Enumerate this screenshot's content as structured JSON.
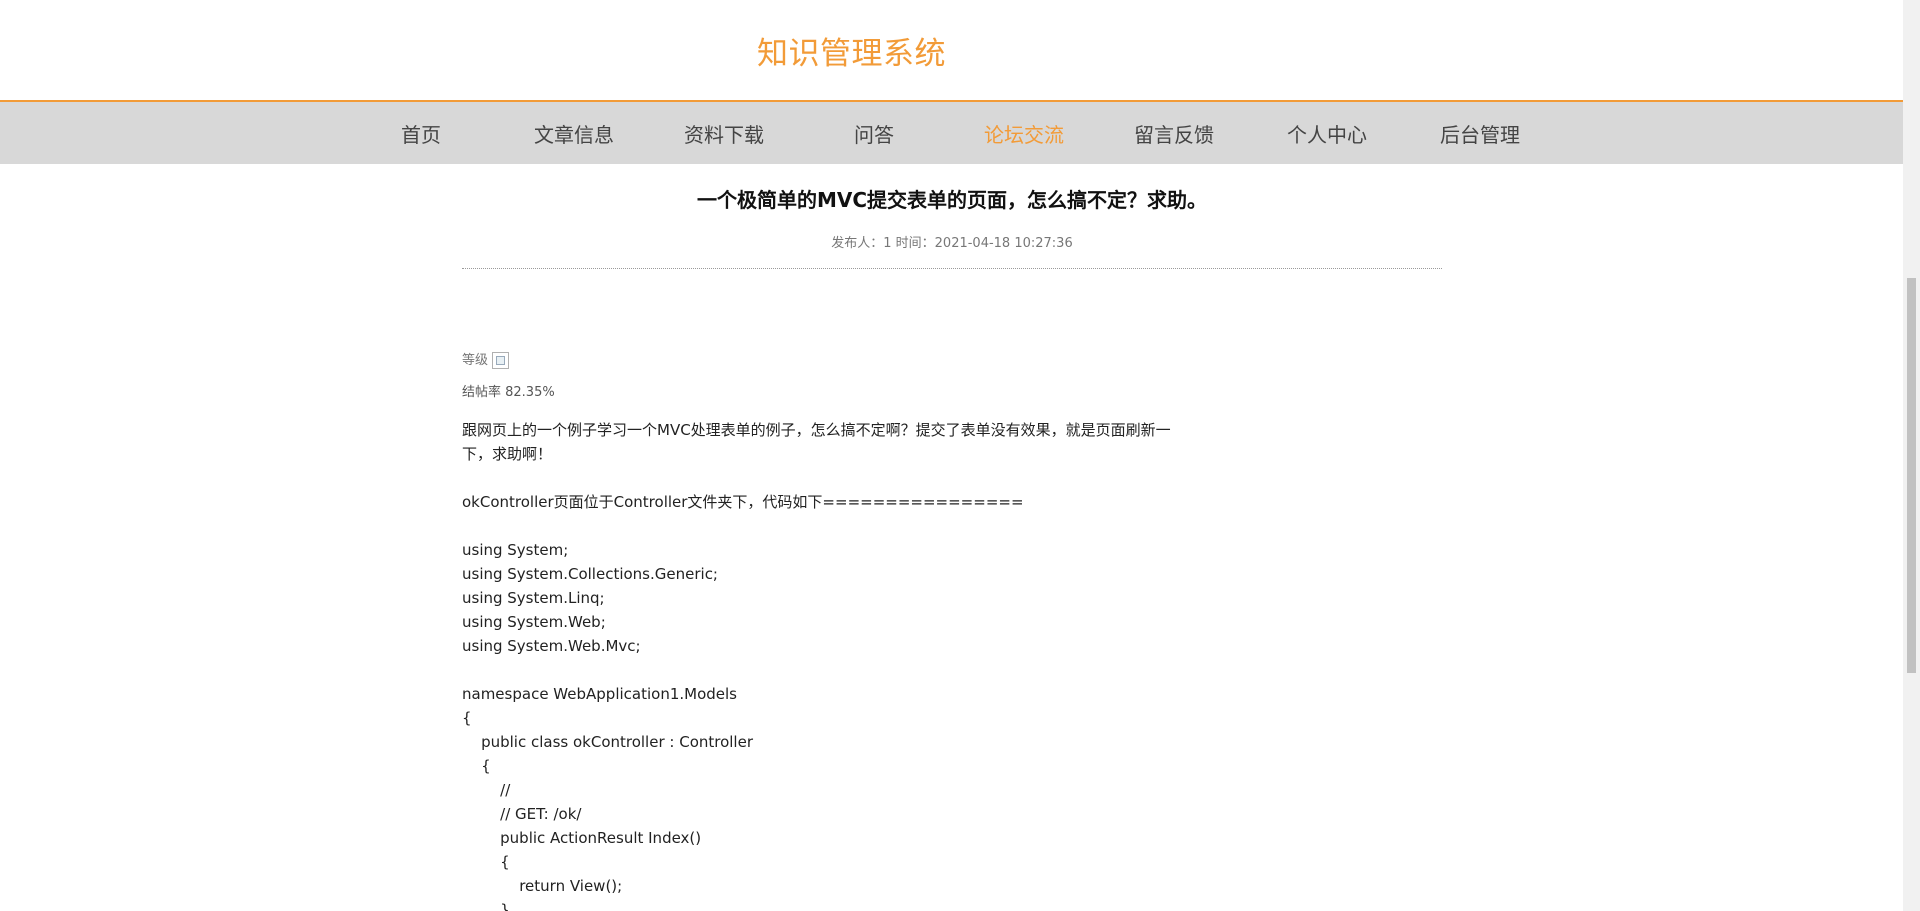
{
  "site": {
    "title": "知识管理系统"
  },
  "nav": {
    "items": [
      {
        "label": "首页"
      },
      {
        "label": "文章信息"
      },
      {
        "label": "资料下载"
      },
      {
        "label": "问答"
      },
      {
        "label": "论坛交流"
      },
      {
        "label": "留言反馈"
      },
      {
        "label": "个人中心"
      },
      {
        "label": "后台管理"
      }
    ],
    "active_label": "论坛交流"
  },
  "post": {
    "title": "一个极简单的MVC提交表单的页面，怎么搞不定？求助。",
    "meta": "发布人：1 时间：2021-04-18 10:27:36",
    "level_label": "等级",
    "rate": "结帖率 82.35%",
    "intro_line1": "跟网页上的一个例子学习一个MVC处理表单的例子，怎么搞不定啊？提交了表单没有效果，就是页面刷新一",
    "intro_line2": "下，求助啊！",
    "location_line": "okController页面位于Controller文件夹下，代码如下================",
    "code": [
      "using System;",
      "using System.Collections.Generic;",
      "using System.Linq;",
      "using System.Web;",
      "using System.Web.Mvc;",
      "",
      "namespace WebApplication1.Models",
      "{",
      "    public class okController : Controller",
      "    {",
      "        //",
      "        // GET: /ok/",
      "        public ActionResult Index()",
      "        {",
      "            return View();",
      "        }"
    ]
  },
  "colors": {
    "accent": "#f29b38",
    "nav_bg": "#d8d8d8"
  }
}
